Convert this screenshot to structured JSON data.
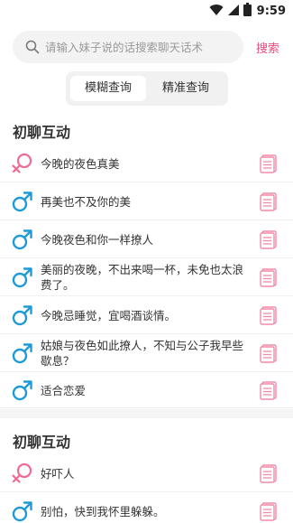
{
  "status_bar": {
    "time": "9:59"
  },
  "search": {
    "placeholder": "请输入妹子说的话搜索聊天话术",
    "button_label": "搜索"
  },
  "mode_tabs": [
    {
      "label": "模糊查询",
      "active": true
    },
    {
      "label": "精准查询",
      "active": false
    }
  ],
  "sections": [
    {
      "title": "初聊互动",
      "items": [
        {
          "gender": "female",
          "text": "今晚的夜色真美"
        },
        {
          "gender": "male",
          "text": "再美也不及你的美"
        },
        {
          "gender": "male",
          "text": "今晚夜色和你一样撩人"
        },
        {
          "gender": "male",
          "text": "美丽的夜晚，不出来喝一杯，未免也太浪费了。"
        },
        {
          "gender": "male",
          "text": "今晚忌睡觉，宜喝酒谈情。"
        },
        {
          "gender": "male",
          "text": "姑娘与夜色如此撩人，不知与公子我早些歇息？"
        },
        {
          "gender": "male",
          "text": "适合恋爱"
        }
      ]
    },
    {
      "title": "初聊互动",
      "items": [
        {
          "gender": "female",
          "text": "好吓人"
        },
        {
          "gender": "male",
          "text": "别怕，快到我怀里躲躲。"
        }
      ]
    }
  ],
  "colors": {
    "accent": "#e84c7d",
    "male": "#1e9ad6",
    "female": "#f06b93",
    "doc_icon": "#f28aa8"
  }
}
